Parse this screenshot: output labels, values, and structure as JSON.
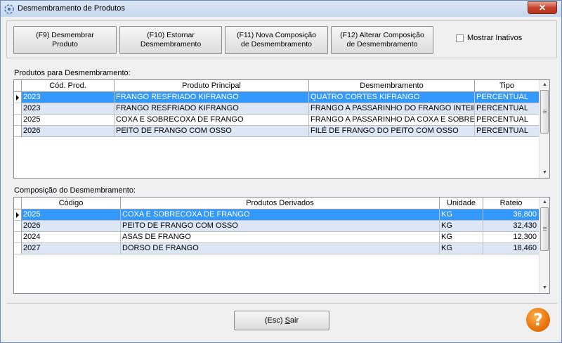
{
  "window": {
    "title": "Desmembramento de Produtos",
    "close_label": "✕"
  },
  "toolbar": {
    "btn_f9": "(F9) Desmembrar\nProduto",
    "btn_f10": "(F10) Estornar\nDesmembramento",
    "btn_f11": "(F11) Nova Composição\nde Desmembramento",
    "btn_f12": "(F12) Alterar Composição\nde Desmembramento",
    "show_inactive_label": "Mostrar Inativos"
  },
  "products_section": {
    "label": "Produtos para Desmembramento:",
    "columns": [
      "Cód. Prod.",
      "Produto Principal",
      "Desmembramento",
      "Tipo"
    ],
    "rows": [
      [
        "2023",
        "FRANGO RESFRIADO KIFRANGO",
        "QUATRO CORTES KIFRANGO",
        "PERCENTUAL"
      ],
      [
        "2023",
        "FRANGO RESFRIADO KIFRANGO",
        "FRANGO A PASSARINHO DO FRANGO INTEIRO",
        "PERCENTUAL"
      ],
      [
        "2025",
        "COXA E SOBRECOXA DE FRANGO",
        "FRANGO A PASSARINHO DA COXA E SOBRECOXA",
        "PERCENTUAL"
      ],
      [
        "2026",
        "PEITO DE FRANGO COM OSSO",
        "FILÉ DE FRANGO DO PEITO COM OSSO",
        "PERCENTUAL"
      ]
    ]
  },
  "composition_section": {
    "label": "Composição do Desmembramento:",
    "columns": [
      "Código",
      "Produtos Derivados",
      "Unidade",
      "Rateio"
    ],
    "rows": [
      [
        "2025",
        "COXA E SOBRECOXA DE FRANGO",
        "KG",
        "36,800"
      ],
      [
        "2026",
        "PEITO DE FRANGO COM OSSO",
        "KG",
        "32,430"
      ],
      [
        "2024",
        "ASAS DE FRANGO",
        "KG",
        "12,300"
      ],
      [
        "2027",
        "DORSO DE FRANGO",
        "KG",
        "18,460"
      ]
    ]
  },
  "footer": {
    "exit_prefix": "(Esc) ",
    "exit_key": "S",
    "exit_rest": "air",
    "help_label": "?"
  }
}
